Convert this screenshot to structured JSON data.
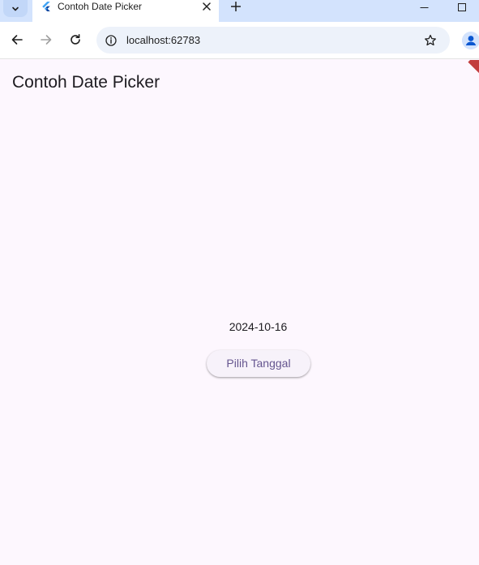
{
  "browser": {
    "tab_title": "Contoh Date Picker",
    "url": "localhost:62783"
  },
  "app": {
    "title": "Contoh Date Picker",
    "selected_date": "2024-10-16",
    "pick_button_label": "Pilih Tanggal"
  },
  "colors": {
    "background": "#fdf7fe",
    "button_text": "#65558f",
    "tabstrip": "#d3e3fd",
    "debug_banner": "#b71c1c"
  },
  "icons": {
    "tab_menu": "chevron-down-icon",
    "favicon": "flutter-icon",
    "tab_close": "close-icon",
    "new_tab": "plus-icon",
    "minimize": "minimize-icon",
    "maximize": "maximize-icon",
    "back": "arrow-left-icon",
    "forward": "arrow-right-icon",
    "reload": "reload-icon",
    "site_info": "info-icon",
    "bookmark": "star-icon",
    "profile": "person-icon"
  }
}
